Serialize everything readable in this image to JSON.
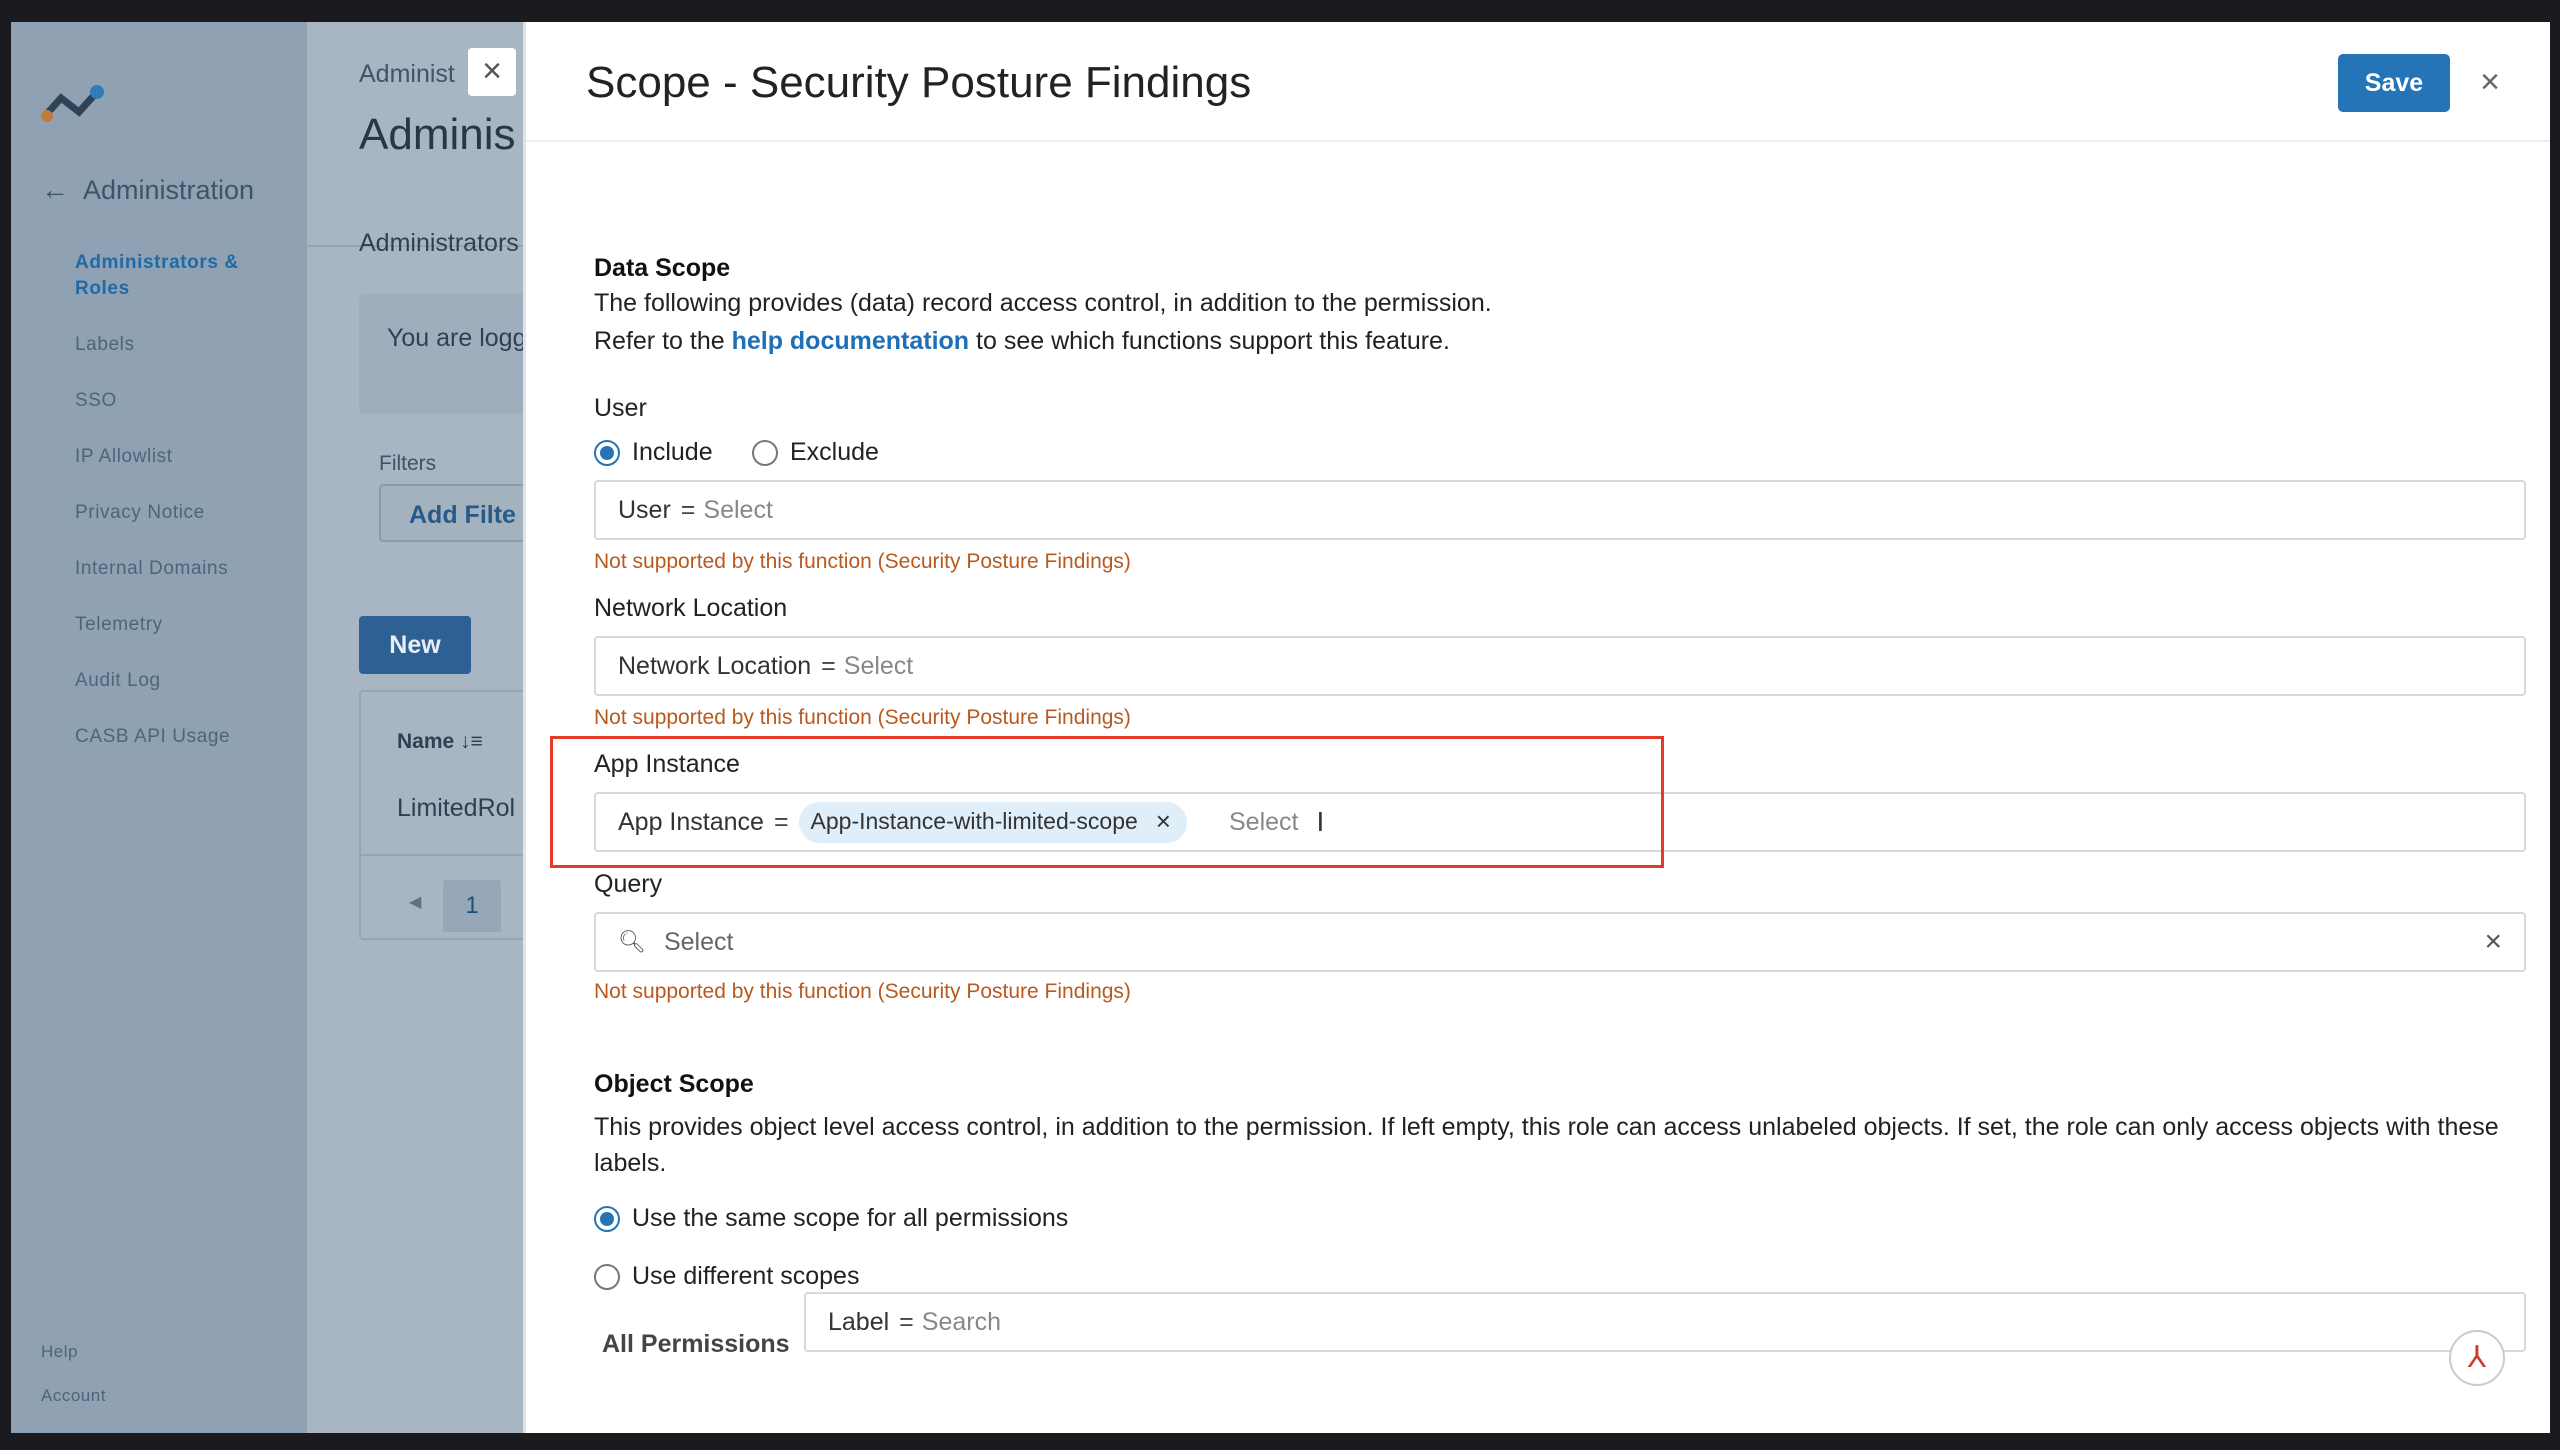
{
  "sidebar": {
    "back_label": "Administration",
    "items": [
      {
        "label": "Administrators & Roles",
        "active": true
      },
      {
        "label": "Labels"
      },
      {
        "label": "SSO"
      },
      {
        "label": "IP Allowlist"
      },
      {
        "label": "Privacy Notice"
      },
      {
        "label": "Internal Domains"
      },
      {
        "label": "Telemetry"
      },
      {
        "label": "Audit Log"
      },
      {
        "label": "CASB API Usage"
      }
    ],
    "help": "Help",
    "account": "Account"
  },
  "background": {
    "breadcrumb": "Administ",
    "title": "Adminis",
    "tab": "Administrators",
    "logged_text": "You are logg",
    "filters_label": "Filters",
    "add_filter": "Add Filte",
    "new_button": "New",
    "column_name": "Name",
    "row_name": "LimitedRol",
    "page": "1"
  },
  "modal": {
    "title": "Scope - Security Posture Findings",
    "save_label": "Save",
    "data_scope": {
      "heading": "Data Scope",
      "line1": "The following provides (data) record access control, in addition to the permission.",
      "line2_pre": "Refer to the ",
      "line2_link": "help documentation",
      "line2_post": " to see which functions support this feature."
    },
    "user": {
      "label": "User",
      "include": "Include",
      "exclude": "Exclude",
      "field_key": "User",
      "eq": "=",
      "placeholder": "Select",
      "warning": "Not supported by this function (Security Posture Findings)"
    },
    "network": {
      "label": "Network Location",
      "field_key": "Network Location",
      "eq": "=",
      "placeholder": "Select",
      "warning": "Not supported by this function (Security Posture Findings)"
    },
    "app_instance": {
      "label": "App Instance",
      "field_key": "App Instance",
      "eq": "=",
      "chip": "App-Instance-with-limited-scope",
      "placeholder": "Select"
    },
    "query": {
      "label": "Query",
      "placeholder": "Select",
      "warning": "Not supported by this function (Security Posture Findings)"
    },
    "object_scope": {
      "heading": "Object Scope",
      "line1": "This provides object level access control, in addition to the permission. If left empty, this role can access unlabeled objects. If set, the role can only access objects with these",
      "line2": "labels.",
      "option_same": "Use the same scope for all permissions",
      "option_diff": "Use different scopes",
      "all_permissions": "All Permissions",
      "label_key": "Label",
      "eq": "=",
      "search_placeholder": "Search"
    }
  },
  "colors": {
    "accent": "#2574b8",
    "warning": "#b8591f",
    "highlight": "#e53a2b"
  }
}
